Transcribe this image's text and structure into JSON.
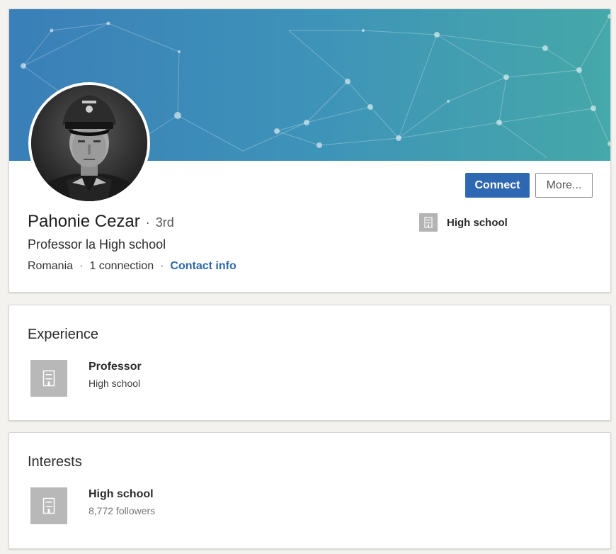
{
  "profile": {
    "name": "Pahonie Cezar",
    "name_separator": "·",
    "degree": "3rd",
    "headline": "Professor la High school",
    "location": "Romania",
    "meta_separator": "·",
    "connections": "1 connection",
    "contact_info_label": "Contact info",
    "connect_label": "Connect",
    "more_label": "More...",
    "current_org": "High school",
    "avatar_icon": "profile-photo",
    "banner_colors": [
      "#3a7fb8",
      "#3e93b9",
      "#45a8a9"
    ]
  },
  "experience": {
    "title": "Experience",
    "items": [
      {
        "position": "Professor",
        "company": "High school",
        "logo_icon": "building-icon"
      }
    ]
  },
  "interests": {
    "title": "Interests",
    "items": [
      {
        "name": "High school",
        "followers": "8,772 followers",
        "logo_icon": "building-icon"
      }
    ]
  },
  "colors": {
    "primary_button": "#2f68b2",
    "link": "#2d67a8",
    "logo_placeholder": "#b8b8b8"
  }
}
